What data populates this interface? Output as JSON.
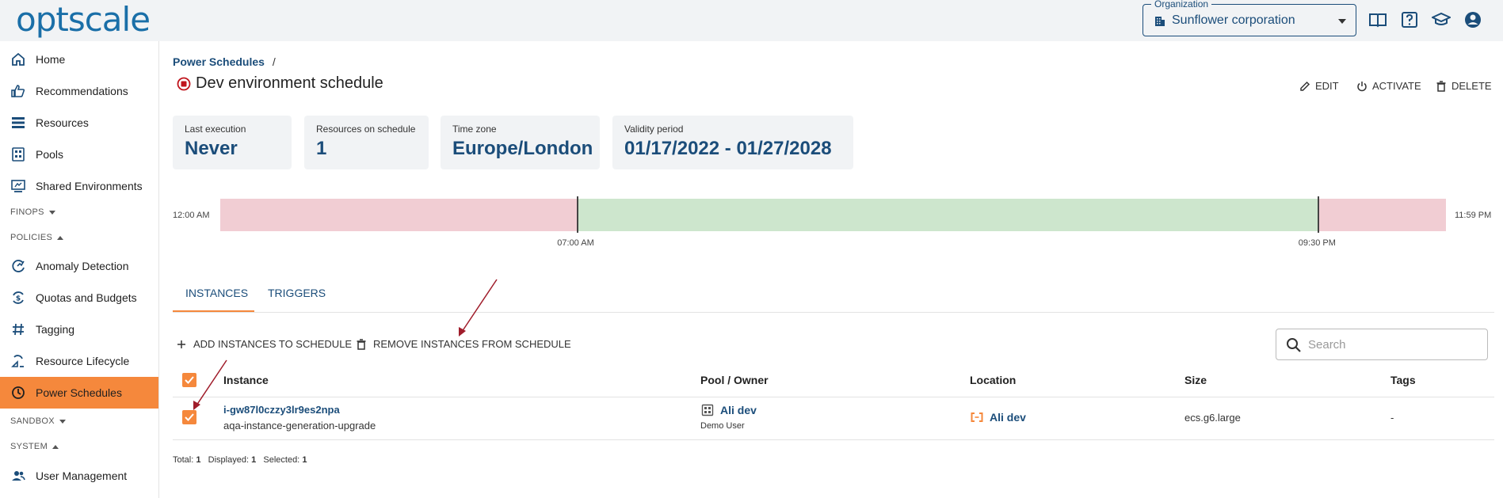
{
  "header": {
    "logo": "optscale",
    "org_label": "Organization",
    "org_value": "Sunflower corporation",
    "icons": [
      "book-icon",
      "help-icon",
      "graduation-cap-icon",
      "account-icon"
    ]
  },
  "sidebar": {
    "items": [
      {
        "label": "Home",
        "icon": "home-icon"
      },
      {
        "label": "Recommendations",
        "icon": "thumbs-up-icon"
      },
      {
        "label": "Resources",
        "icon": "list-icon"
      },
      {
        "label": "Pools",
        "icon": "pools-icon"
      },
      {
        "label": "Shared Environments",
        "icon": "monitor-icon"
      }
    ],
    "finops": "FINOPS",
    "policies": "POLICIES",
    "policy_items": [
      {
        "label": "Anomaly Detection",
        "icon": "anomaly-icon"
      },
      {
        "label": "Quotas and Budgets",
        "icon": "quota-icon"
      },
      {
        "label": "Tagging",
        "icon": "hash-icon"
      },
      {
        "label": "Resource Lifecycle",
        "icon": "lifecycle-icon"
      },
      {
        "label": "Power Schedules",
        "icon": "clock-icon"
      }
    ],
    "sandbox": "SANDBOX",
    "system": "SYSTEM",
    "system_items": [
      {
        "label": "User Management",
        "icon": "users-icon"
      }
    ]
  },
  "breadcrumb": {
    "root": "Power Schedules",
    "separator": "/"
  },
  "page": {
    "title": "Dev environment schedule",
    "actions": {
      "edit": "EDIT",
      "activate": "ACTIVATE",
      "delete": "DELETE"
    }
  },
  "cards": [
    {
      "label": "Last execution",
      "value": "Never"
    },
    {
      "label": "Resources on schedule",
      "value": "1"
    },
    {
      "label": "Time zone",
      "value": "Europe/London"
    },
    {
      "label": "Validity period",
      "value": "01/17/2022 - 01/27/2028"
    }
  ],
  "timeline": {
    "start": "12:00 AM",
    "end": "11:59 PM",
    "on": "07:00 AM",
    "off": "09:30 PM",
    "on_fraction": 0.2917,
    "off_fraction": 0.8958,
    "colors": {
      "off": "#f1cdd3",
      "on": "#cde6cd"
    }
  },
  "tabs": {
    "instances": "INSTANCES",
    "triggers": "TRIGGERS"
  },
  "table_actions": {
    "add": "ADD INSTANCES TO SCHEDULE",
    "remove": "REMOVE INSTANCES FROM SCHEDULE",
    "search_placeholder": "Search"
  },
  "table": {
    "headers": {
      "instance": "Instance",
      "pool_owner": "Pool / Owner",
      "location": "Location",
      "size": "Size",
      "tags": "Tags"
    },
    "rows": [
      {
        "instance_id": "i-gw87l0czzy3lr9es2npa",
        "instance_name": "aqa-instance-generation-upgrade",
        "pool": "Ali dev",
        "owner": "Demo User",
        "location": "Ali dev",
        "size": "ecs.g6.large",
        "tags": "-"
      }
    ]
  },
  "summary": {
    "total_label": "Total:",
    "total": "1",
    "displayed_label": "Displayed:",
    "displayed": "1",
    "selected_label": "Selected:",
    "selected": "1"
  },
  "colors": {
    "accent": "#f5883c",
    "brand": "#1b4d7a",
    "arrow": "#a01d2b"
  }
}
